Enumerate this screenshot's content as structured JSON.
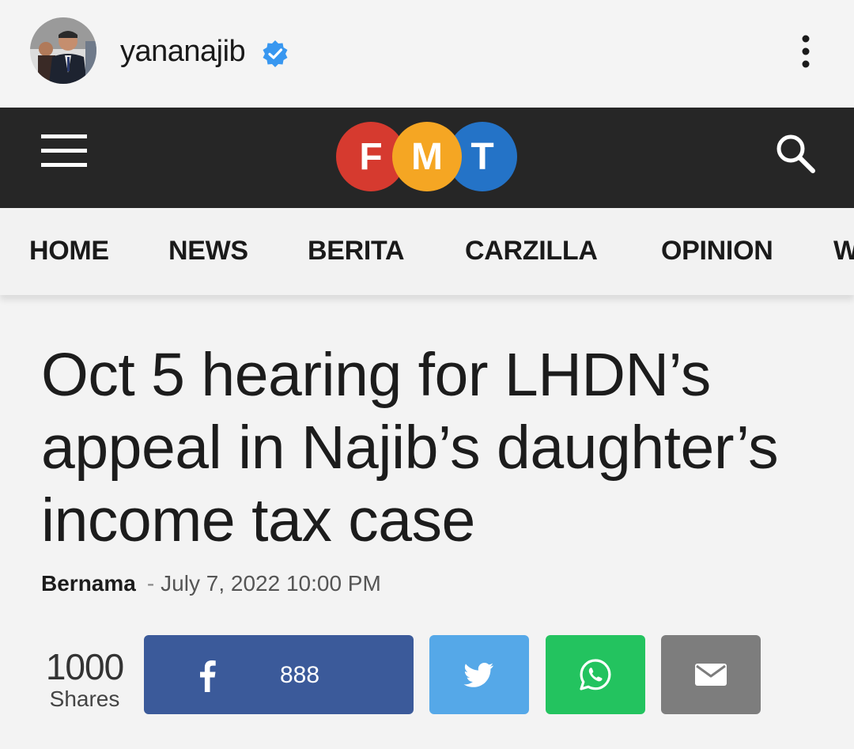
{
  "post": {
    "username": "yananajib",
    "verified": true
  },
  "site": {
    "logo_letters": [
      "F",
      "M",
      "T"
    ],
    "logo_colors": [
      "#d63a2f",
      "#f5a623",
      "#2473c7"
    ],
    "topbar_color": "#262626"
  },
  "nav": {
    "items": [
      "HOME",
      "NEWS",
      "BERITA",
      "CARZILLA",
      "OPINION",
      "W"
    ]
  },
  "article": {
    "headline_lines": [
      "Oct 5 hearing for LHDN’s",
      "appeal in Najib’s daughter’s",
      "income tax case"
    ],
    "author": "Bernama",
    "separator": "-",
    "date": "July 7, 2022 10:00 PM"
  },
  "shares": {
    "count": "1000",
    "label": "Shares",
    "facebook_count": "888",
    "buttons": [
      {
        "name": "facebook",
        "color": "#3b5a9a"
      },
      {
        "name": "twitter",
        "color": "#55a8e8"
      },
      {
        "name": "whatsapp",
        "color": "#23c35f"
      },
      {
        "name": "email",
        "color": "#7d7d7d"
      }
    ]
  }
}
